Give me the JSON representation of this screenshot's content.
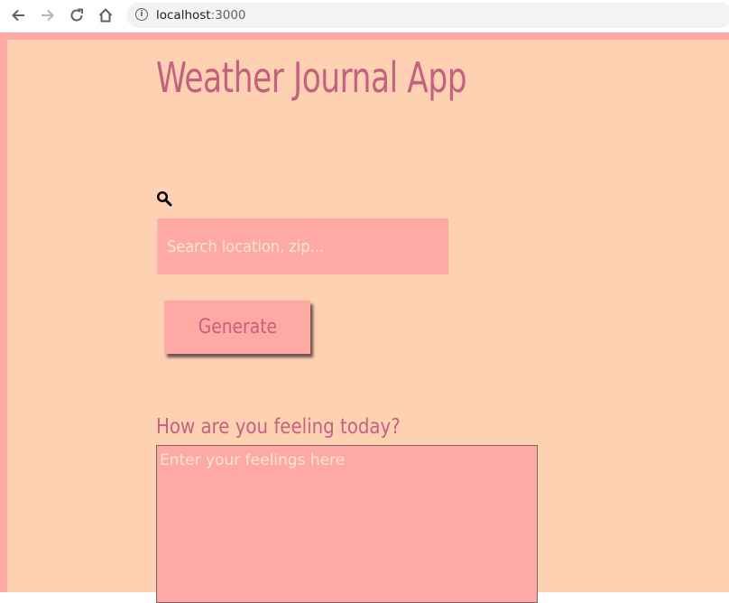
{
  "browser": {
    "back_icon": "arrow-left-icon",
    "forward_icon": "arrow-right-icon",
    "reload_icon": "reload-icon",
    "home_icon": "home-icon",
    "info_icon": "info-icon",
    "url_host": "localhost",
    "url_port": ":3000"
  },
  "app": {
    "title": "Weather Journal App",
    "search_icon": "search-icon",
    "zip_placeholder": "Search location, zip...",
    "generate_label": "Generate",
    "feelings_label": "How are you feeling today?",
    "feelings_placeholder": "Enter your feelings here"
  },
  "colors": {
    "page_border": "#ffa9a5",
    "page_background": "#fed1b3",
    "accent_text": "#c3617e",
    "input_background": "#ffa9a5",
    "placeholder_text": "#fde5d5"
  }
}
